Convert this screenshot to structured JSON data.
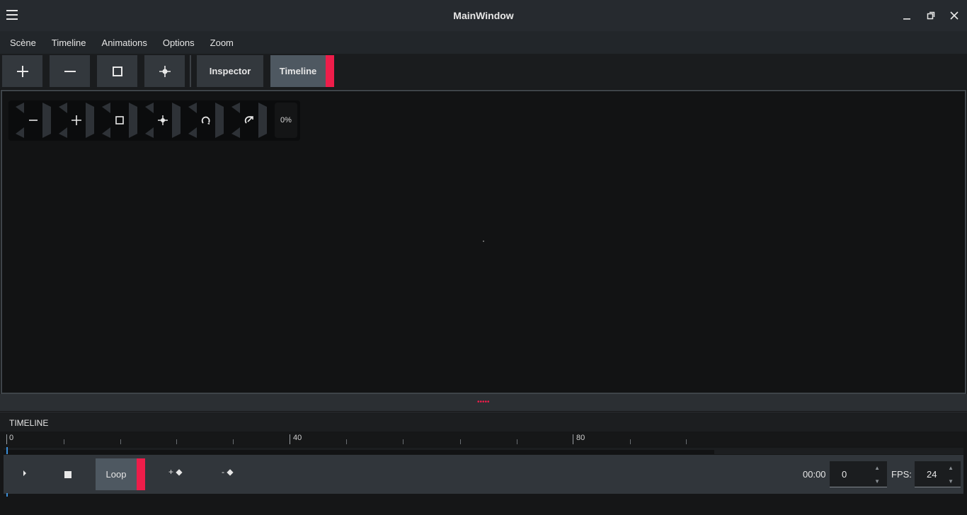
{
  "window": {
    "title": "MainWindow"
  },
  "menubar": {
    "items": [
      "Scène",
      "Timeline",
      "Animations",
      "Options",
      "Zoom"
    ]
  },
  "toolbar": {
    "inspector_label": "Inspector",
    "timeline_label": "Timeline",
    "icons": [
      "plus-icon",
      "minus-icon",
      "square-icon",
      "crosshair-icon"
    ]
  },
  "canvas": {
    "zoom_percent": "0%",
    "tool_icons": [
      "zoom-out-icon",
      "zoom-in-icon",
      "square-icon",
      "pivot-icon",
      "rotate-icon",
      "reset-rotate-icon"
    ]
  },
  "timeline": {
    "header": "TIMELINE",
    "ruler_labels": [
      "0",
      "40",
      "80"
    ],
    "loop_label": "Loop",
    "add_key_label": "+ ◆",
    "remove_key_label": "- ◆",
    "time": "00:00",
    "frame_value": "0",
    "fps_label": "FPS:",
    "fps_value": "24"
  },
  "colors": {
    "accent": "#ee1d4a",
    "playhead": "#3c8fd8",
    "active_button": "#4e5861"
  }
}
